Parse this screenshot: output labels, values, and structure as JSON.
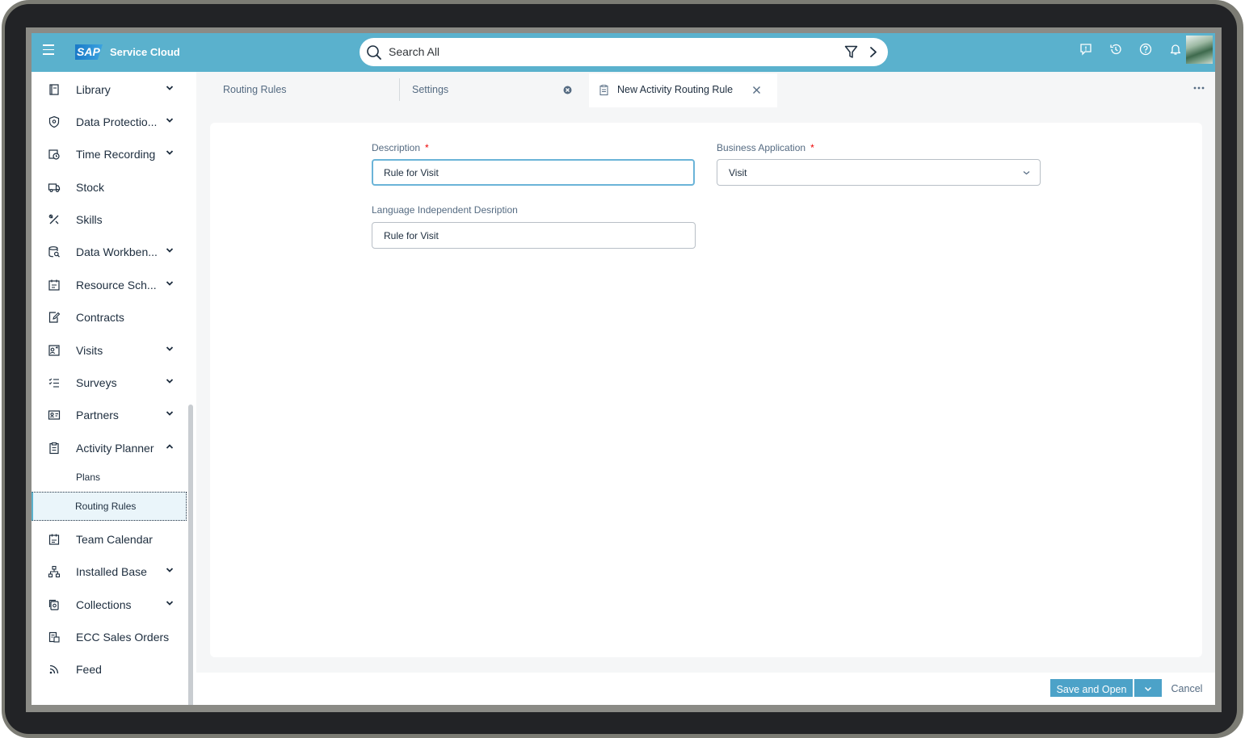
{
  "shell": {
    "product_name": "Service Cloud",
    "logo_text": "SAP",
    "search_placeholder": "Search All",
    "colors": {
      "shellbar": "#5ab1cd",
      "accent": "#4ca2c8"
    }
  },
  "sidebar": {
    "items": [
      {
        "label": "Library",
        "icon": "book-icon",
        "expandable": true
      },
      {
        "label": "Data Protectio...",
        "icon": "shield-icon",
        "expandable": true
      },
      {
        "label": "Time Recording",
        "icon": "clock-calendar-icon",
        "expandable": true
      },
      {
        "label": "Stock",
        "icon": "truck-icon",
        "expandable": false
      },
      {
        "label": "Skills",
        "icon": "tools-icon",
        "expandable": false
      },
      {
        "label": "Data Workben...",
        "icon": "database-search-icon",
        "expandable": true
      },
      {
        "label": "Resource Sch...",
        "icon": "schedule-icon",
        "expandable": true
      },
      {
        "label": "Contracts",
        "icon": "edit-document-icon",
        "expandable": false
      },
      {
        "label": "Visits",
        "icon": "visit-icon",
        "expandable": true
      },
      {
        "label": "Surveys",
        "icon": "checklist-icon",
        "expandable": true
      },
      {
        "label": "Partners",
        "icon": "partner-card-icon",
        "expandable": true
      },
      {
        "label": "Activity Planner",
        "icon": "clipboard-icon",
        "expandable": true,
        "expanded": true
      },
      {
        "label": "Team Calendar",
        "icon": "calendar-icon",
        "expandable": false
      },
      {
        "label": "Installed Base",
        "icon": "hierarchy-icon",
        "expandable": true
      },
      {
        "label": "Collections",
        "icon": "collections-icon",
        "expandable": true
      },
      {
        "label": "ECC Sales Orders",
        "icon": "sales-order-icon",
        "expandable": false
      },
      {
        "label": "Feed",
        "icon": "feed-icon",
        "expandable": false
      }
    ],
    "sub_items": [
      {
        "label": "Plans"
      },
      {
        "label": "Routing Rules",
        "selected": true
      }
    ]
  },
  "tabs": [
    {
      "label": "Routing Rules"
    },
    {
      "label": "Settings"
    },
    {
      "label": "New Activity Routing Rule",
      "active": true
    }
  ],
  "form": {
    "description": {
      "label": "Description",
      "required_mark": "*",
      "value": "Rule for Visit"
    },
    "business_application": {
      "label": "Business Application",
      "required_mark": "*",
      "value": "Visit"
    },
    "lang_independent": {
      "label": "Language Independent Desription",
      "value": "Rule for Visit"
    }
  },
  "footer": {
    "save_label": "Save and Open",
    "cancel_label": "Cancel"
  }
}
